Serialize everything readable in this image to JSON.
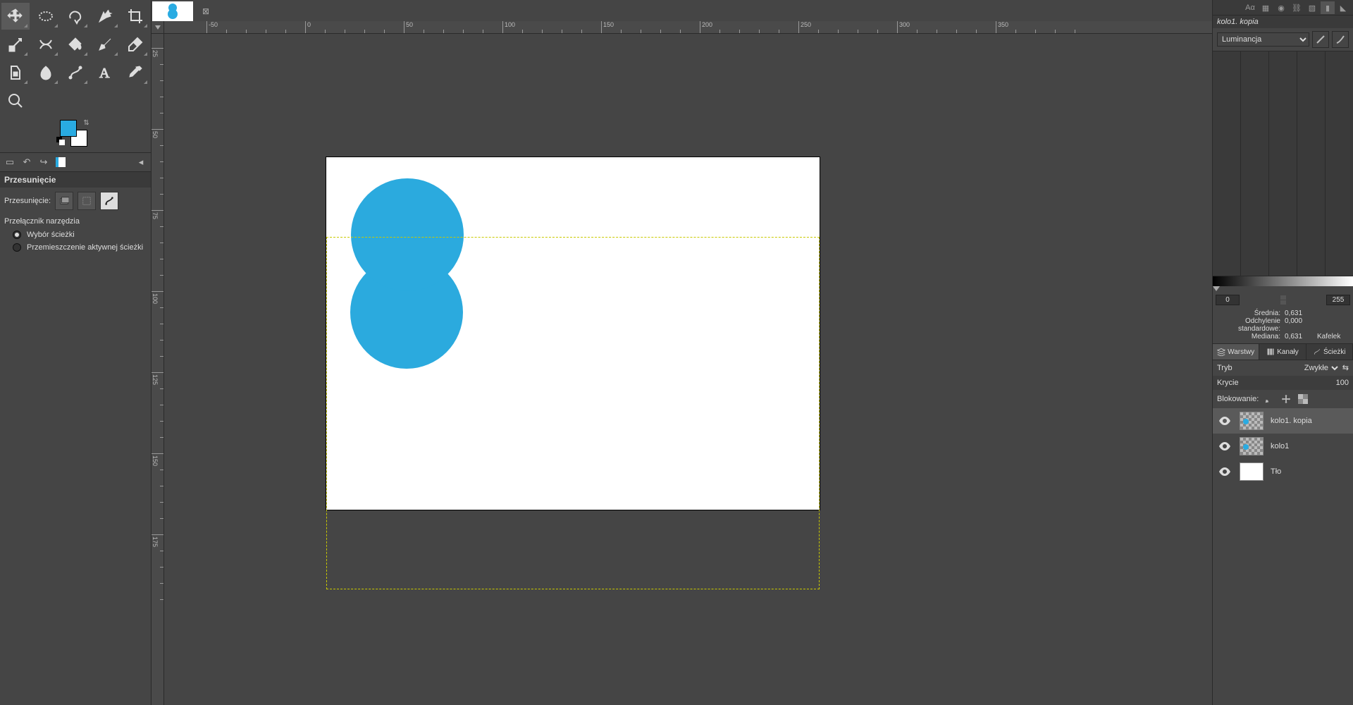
{
  "active_layer_label": "kolo1. kopia",
  "histogram": {
    "channel": "Luminancja",
    "range_min": "0",
    "range_max": "255",
    "stats": {
      "mean_label": "Średnia:",
      "mean_value": "0,631",
      "stddev_label": "Odchylenie standardowe:",
      "stddev_value": "0,000",
      "median_label": "Mediana:",
      "median_value": "0,631",
      "tiles_label": "Kafelek"
    }
  },
  "panel_tabs": {
    "layers": "Warstwy",
    "channels": "Kanały",
    "paths": "Ścieżki"
  },
  "layer_panel": {
    "mode_label": "Tryb",
    "mode_value": "Zwykłe",
    "opacity_label": "Krycie",
    "opacity_value": "100",
    "lock_label": "Blokowanie:"
  },
  "layers": [
    {
      "name": "kolo1. kopia",
      "thumb": "chk-dot",
      "selected": true
    },
    {
      "name": "kolo1",
      "thumb": "chk-dot",
      "selected": false
    },
    {
      "name": "Tło",
      "thumb": "white",
      "selected": false
    }
  ],
  "tool_options": {
    "title": "Przesunięcie",
    "move_label": "Przesunięcie:",
    "switch_label": "Przełącznik narzędzia",
    "radio1": "Wybór ścieżki",
    "radio2": "Przemieszczenie aktywnej ścieżki"
  },
  "ruler_h": [
    "-50",
    "0",
    "50",
    "100",
    "150",
    "200",
    "250",
    "300",
    "350"
  ],
  "ruler_v": [
    "25",
    "50",
    "75",
    "100",
    "125",
    "150",
    "175"
  ]
}
